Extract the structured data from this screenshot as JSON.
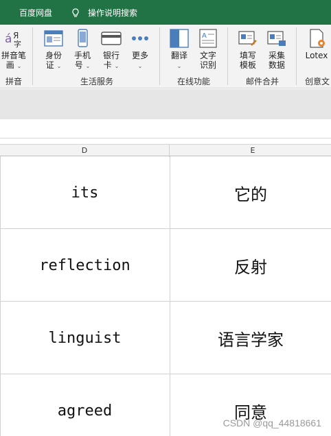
{
  "tabs": {
    "baidu": "百度网盘",
    "tell": "操作说明搜索"
  },
  "ribbon": {
    "groups": [
      {
        "label": "拼音",
        "buttons": [
          {
            "line1": "拼音笔",
            "line2": "画"
          }
        ]
      },
      {
        "label": "生活服务",
        "buttons": [
          {
            "line1": "身份",
            "line2": "证"
          },
          {
            "line1": "手机",
            "line2": "号"
          },
          {
            "line1": "银行",
            "line2": "卡"
          },
          {
            "line1": "更多",
            "line2": ""
          }
        ]
      },
      {
        "label": "在线功能",
        "buttons": [
          {
            "line1": "翻译",
            "line2": ""
          },
          {
            "line1": "文字",
            "line2": "识别"
          }
        ]
      },
      {
        "label": "邮件合并",
        "buttons": [
          {
            "line1": "填写",
            "line2": "模板"
          },
          {
            "line1": "采集",
            "line2": "数据"
          }
        ]
      },
      {
        "label": "创意文",
        "buttons": [
          {
            "line1": "Lotex",
            "line2": ""
          }
        ]
      }
    ]
  },
  "columns": {
    "d": "D",
    "e": "E"
  },
  "rows": [
    {
      "d": "its",
      "e": "它的"
    },
    {
      "d": "reflection",
      "e": "反射"
    },
    {
      "d": "linguist",
      "e": "语言学家"
    },
    {
      "d": "agreed",
      "e": "同意"
    }
  ],
  "watermark": "CSDN @qq_44818661",
  "colors": {
    "green": "#217346",
    "accent": "#4a7ebb"
  }
}
